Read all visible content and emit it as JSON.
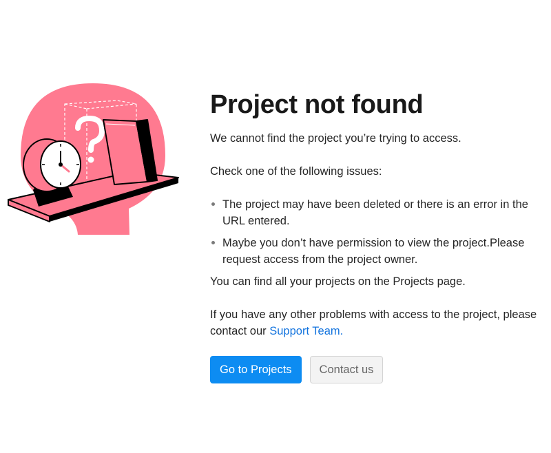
{
  "page": {
    "title": "Project not found",
    "description": "We cannot find the project you’re trying to access.",
    "issues_intro": "Check one of the following issues:",
    "issues": [
      "The project may have been deleted or there is an error in the URL entered.",
      "Maybe you don’t have permission to view the project.Please request access from the project owner."
    ],
    "projects_hint": "You can find all your projects on the Projects page.",
    "support_text": "If you have any other problems with access to the project, please contact our",
    "support_link": "Support Team."
  },
  "buttons": {
    "primary_label": "Go to Projects",
    "secondary_label": "Contact us"
  },
  "illustration": {
    "icon": "clock-on-shelf-question-illustration",
    "accent_color": "#ff7a90",
    "ink_color": "#000000"
  },
  "colors": {
    "link": "#1273de",
    "primary_button": "#0d8cf2",
    "secondary_button_bg": "#f3f3f3",
    "secondary_button_text": "#666666"
  }
}
